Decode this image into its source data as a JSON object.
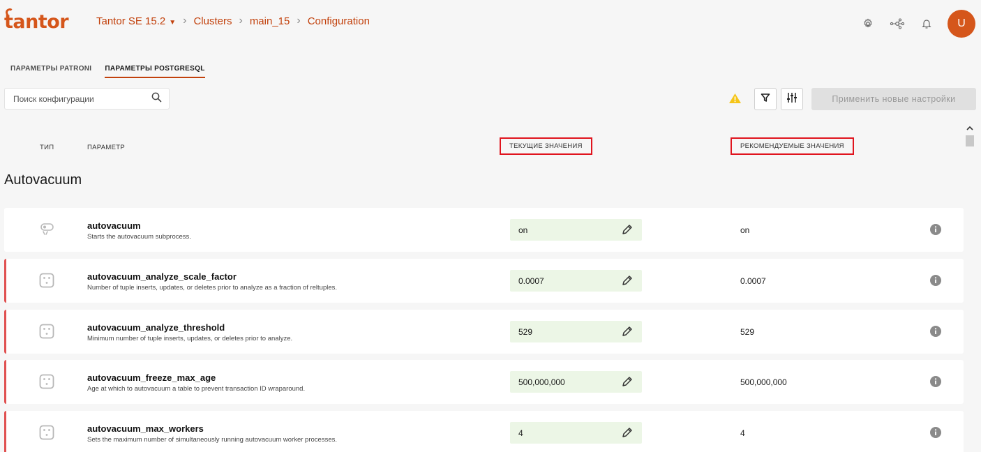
{
  "header": {
    "logo_text": "tantor",
    "breadcrumb": {
      "product": "Tantor SE 15.2",
      "clusters": "Clusters",
      "cluster": "main_15",
      "page": "Configuration"
    },
    "avatar_letter": "U",
    "icons": [
      "gear-icon",
      "network-icon",
      "bell-icon"
    ]
  },
  "tabs": [
    {
      "label": "ПАРАМЕТРЫ PATRONI",
      "active": false
    },
    {
      "label": "ПАРАМЕТРЫ POSTGRESQL",
      "active": true
    }
  ],
  "search": {
    "placeholder": "Поиск конфигурации"
  },
  "toolbar": {
    "apply_label": "Применить новые настройки"
  },
  "columns": {
    "type": "ТИП",
    "param": "ПАРАМЕТР",
    "current": "ТЕКУЩИЕ ЗНАЧЕНИЯ",
    "recommended": "РЕКОМЕНДУЕМЫЕ ЗНАЧЕНИЯ"
  },
  "section": {
    "title": "Autovacuum"
  },
  "rows": [
    {
      "name": "autovacuum",
      "desc": "Starts the autovacuum subprocess.",
      "current": "on",
      "recommended": "on",
      "type_icon": "toggle-icon",
      "flagged": false
    },
    {
      "name": "autovacuum_analyze_scale_factor",
      "desc": "Number of tuple inserts, updates, or deletes prior to analyze as a fraction of reltuples.",
      "current": "0.0007",
      "recommended": "0.0007",
      "type_icon": "numeric-icon",
      "flagged": true
    },
    {
      "name": "autovacuum_analyze_threshold",
      "desc": "Minimum number of tuple inserts, updates, or deletes prior to analyze.",
      "current": "529",
      "recommended": "529",
      "type_icon": "numeric-icon",
      "flagged": true
    },
    {
      "name": "autovacuum_freeze_max_age",
      "desc": "Age at which to autovacuum a table to prevent transaction ID wraparound.",
      "current": "500,000,000",
      "recommended": "500,000,000",
      "type_icon": "numeric-icon",
      "flagged": true
    },
    {
      "name": "autovacuum_max_workers",
      "desc": "Sets the maximum number of simultaneously running autovacuum worker processes.",
      "current": "4",
      "recommended": "4",
      "type_icon": "numeric-icon",
      "flagged": true
    }
  ],
  "colors": {
    "accent": "#c2410c",
    "brand": "#d5561b",
    "current_bg": "#ecf6e6",
    "flag": "#e05050",
    "highlight": "#e0141e"
  }
}
